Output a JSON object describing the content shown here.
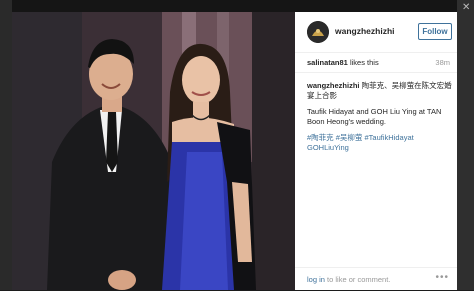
{
  "post": {
    "username": "wangzhezhizhi",
    "follow_label": "Follow",
    "likes_user": "salinatan81",
    "likes_suffix": " likes this",
    "time_ago": "38m",
    "caption_user": "wangzhezhizhi",
    "caption_chinese": "陶菲克、吴柳萤在陈文宏婚宴上合影",
    "caption_english": "Taufik Hidayat and GOH Liu Ying at TAN Boon Heong's wedding.",
    "hashtags_line1": "#陶菲克 #吴柳萤 #TaufikHidayat",
    "hashtags_line2": "GOHLiuYing"
  },
  "footer": {
    "login_label": "log in",
    "footer_text": " to like or comment.",
    "more_icon": "ellipsis-icon"
  },
  "colors": {
    "link": "#3f729b",
    "muted": "#999999",
    "text": "#262626"
  }
}
